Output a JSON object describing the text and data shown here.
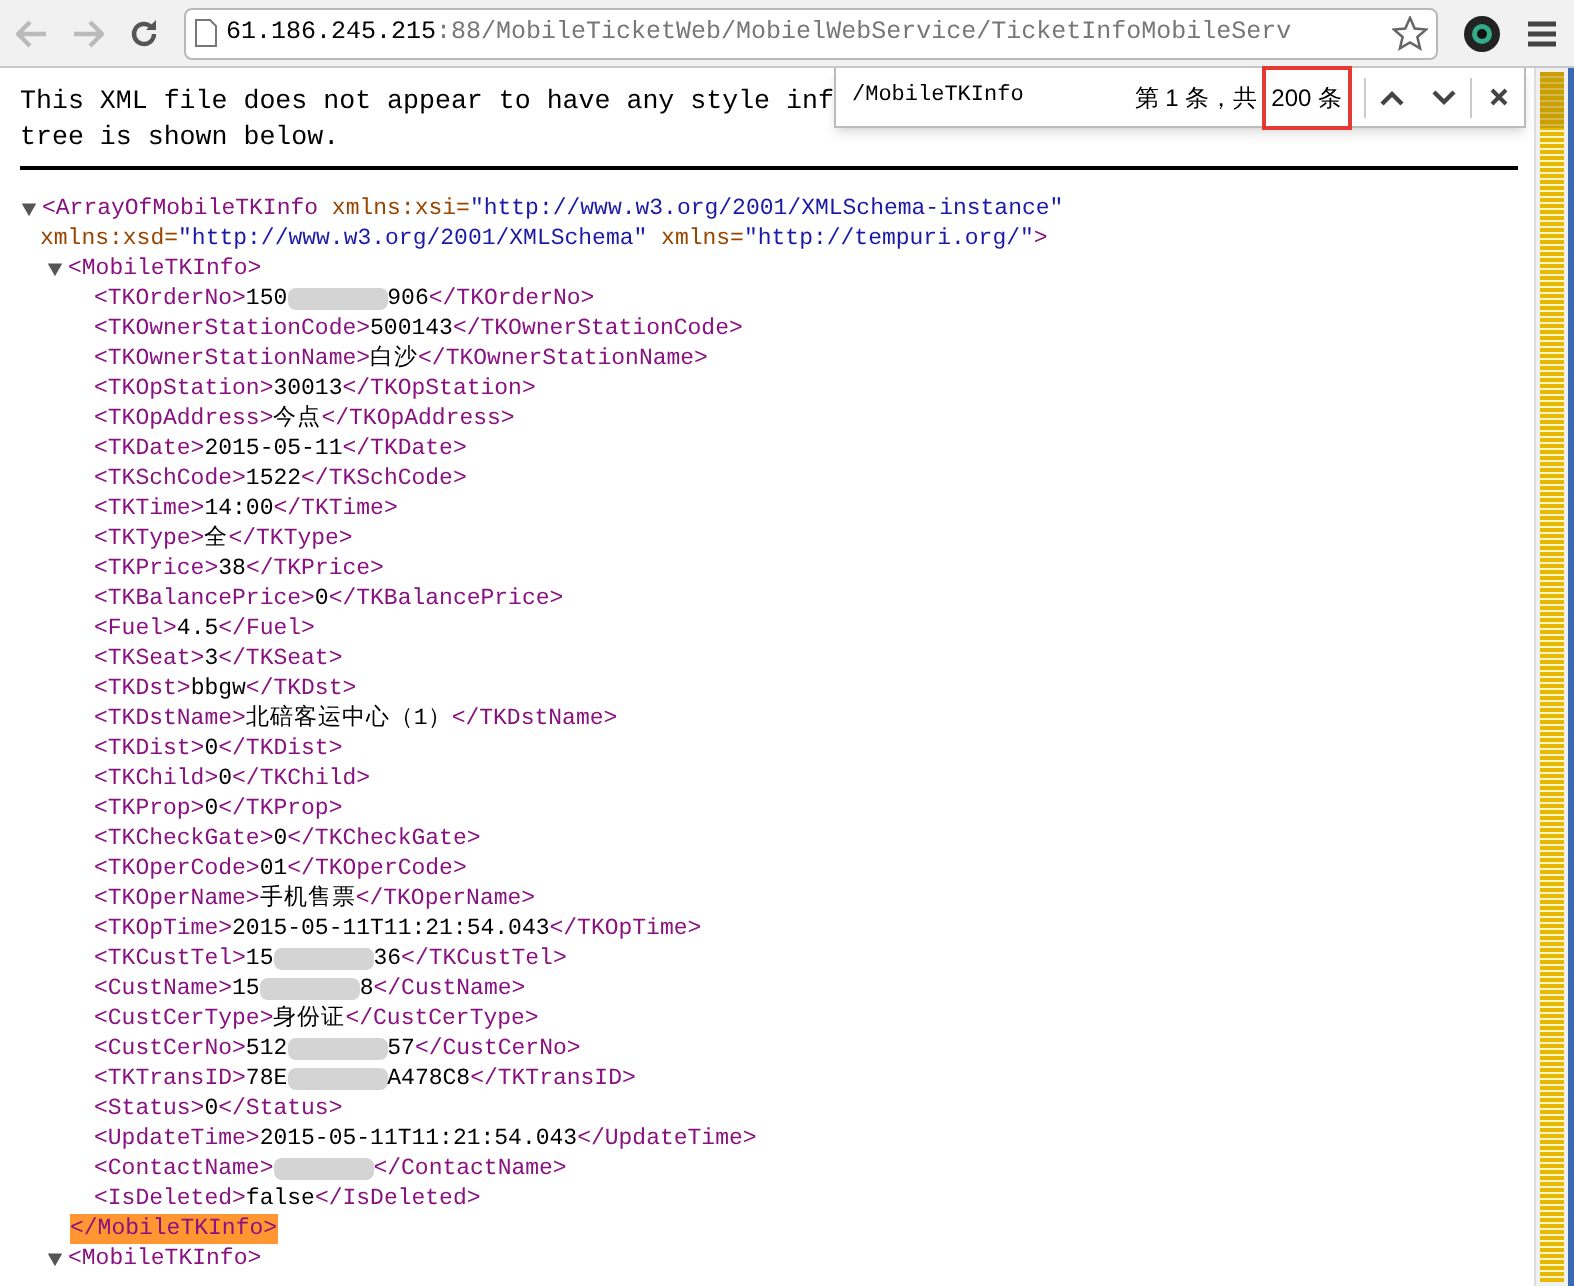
{
  "toolbar": {
    "url_host": "61.186.245.215",
    "url_rest": ":88/MobileTicketWeb/MobielWebService/TicketInfoMobileServ"
  },
  "notice": [
    "This XML file does not appear to have any style inf",
    "tree is shown below."
  ],
  "find_bar": {
    "query": "/MobileTKInfo",
    "result": "第 1 条，共",
    "count": "200 条",
    "count_marked": true
  },
  "xml": {
    "root": {
      "open": "<ArrayOfMobileTKInfo",
      "expanded": true,
      "attributes": [
        {
          "name": "xmlns:xsi=",
          "value": "\"http://www.w3.org/2001/XMLSchema-instance\""
        }
      ],
      "attributes_continued": [
        {
          "name": "xmlns:xsd=",
          "value": "\"http://www.w3.org/2001/XMLSchema\""
        },
        {
          "name": "xmlns=",
          "value": "\"http://tempuri.org/\""
        }
      ],
      "open_end": ">"
    },
    "records": [
      {
        "open": "<MobileTKInfo>",
        "close": "</MobileTKInfo>",
        "expanded": true,
        "closing_highlighted": true,
        "fields": [
          {
            "open": "<TKOrderNo>",
            "value": "150",
            "redacted": true,
            "value_after": "906",
            "close": "</TKOrderNo>"
          },
          {
            "open": "<TKOwnerStationCode>",
            "value": "500143",
            "close": "</TKOwnerStationCode>"
          },
          {
            "open": "<TKOwnerStationName>",
            "value": "白沙",
            "close": "</TKOwnerStationName>"
          },
          {
            "open": "<TKOpStation>",
            "value": "30013",
            "close": "</TKOpStation>"
          },
          {
            "open": "<TKOpAddress>",
            "value": "今点",
            "close": "</TKOpAddress>"
          },
          {
            "open": "<TKDate>",
            "value": "2015-05-11",
            "close": "</TKDate>"
          },
          {
            "open": "<TKSchCode>",
            "value": "1522",
            "close": "</TKSchCode>"
          },
          {
            "open": "<TKTime>",
            "value": "14:00",
            "close": "</TKTime>"
          },
          {
            "open": "<TKType>",
            "value": "全",
            "close": "</TKType>"
          },
          {
            "open": "<TKPrice>",
            "value": "38",
            "close": "</TKPrice>"
          },
          {
            "open": "<TKBalancePrice>",
            "value": "0",
            "close": "</TKBalancePrice>"
          },
          {
            "open": "<Fuel>",
            "value": "4.5",
            "close": "</Fuel>"
          },
          {
            "open": "<TKSeat>",
            "value": "3",
            "close": "</TKSeat>"
          },
          {
            "open": "<TKDst>",
            "value": "bbgw",
            "close": "</TKDst>"
          },
          {
            "open": "<TKDstName>",
            "value": "北碚客运中心（1）",
            "close": "</TKDstName>"
          },
          {
            "open": "<TKDist>",
            "value": "0",
            "close": "</TKDist>"
          },
          {
            "open": "<TKChild>",
            "value": "0",
            "close": "</TKChild>"
          },
          {
            "open": "<TKProp>",
            "value": "0",
            "close": "</TKProp>"
          },
          {
            "open": "<TKCheckGate>",
            "value": "0",
            "close": "</TKCheckGate>"
          },
          {
            "open": "<TKOperCode>",
            "value": "01",
            "close": "</TKOperCode>"
          },
          {
            "open": "<TKOperName>",
            "value": "手机售票",
            "close": "</TKOperName>"
          },
          {
            "open": "<TKOpTime>",
            "value": "2015-05-11T11:21:54.043",
            "close": "</TKOpTime>"
          },
          {
            "open": "<TKCustTel>",
            "value": "15",
            "redacted": true,
            "value_after": "36",
            "close": "</TKCustTel>"
          },
          {
            "open": "<CustName>",
            "value": "15",
            "redacted": true,
            "value_after": "8",
            "close": "</CustName>"
          },
          {
            "open": "<CustCerType>",
            "value": "身份证",
            "close": "</CustCerType>"
          },
          {
            "open": "<CustCerNo>",
            "value": "512",
            "redacted": true,
            "value_after": "57",
            "close": "</CustCerNo>"
          },
          {
            "open": "<TKTransID>",
            "value": "78E",
            "redacted": true,
            "value_after": "A478C8",
            "close": "</TKTransID>"
          },
          {
            "open": "<Status>",
            "value": "0",
            "close": "</Status>"
          },
          {
            "open": "<UpdateTime>",
            "value": "2015-05-11T11:21:54.043",
            "close": "</UpdateTime>"
          },
          {
            "open": "<ContactName>",
            "redacted": true,
            "close": "</ContactName>"
          },
          {
            "open": "<IsDeleted>",
            "value": "false",
            "close": "</IsDeleted>"
          }
        ]
      },
      {
        "open": "<MobileTKInfo>",
        "expanded": true
      }
    ]
  }
}
